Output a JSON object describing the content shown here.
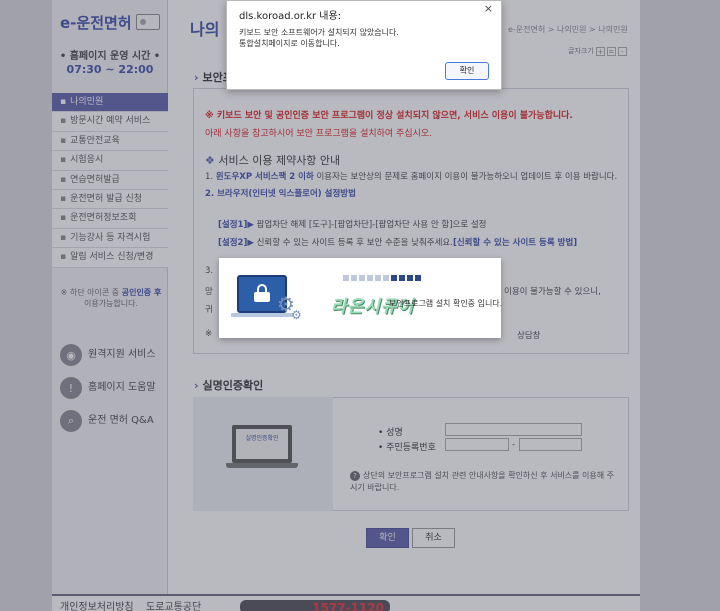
{
  "sidebar": {
    "logo": "e-운전면허",
    "hours_title": "• 홈페이지 운영 시간 •",
    "hours_time": "07:30 ~ 22:00",
    "nav": [
      "나의민원",
      "방문시간 예약 서비스",
      "교통안전교육",
      "시험응시",
      "연습면허발급",
      "운전면허 발급 신청",
      "운전면허정보조회",
      "기능강사 등 자격시험",
      "알림 서비스 신청/변경"
    ],
    "note_prefix": "※ 하단 아이콘 중 ",
    "note_link": "공인인증 후",
    "note_suffix": " 이용가능합니다.",
    "services": [
      {
        "icon": "wifi-icon",
        "label": "원격지원 서비스"
      },
      {
        "icon": "exclamation-icon",
        "label": "홈페이지 도움말"
      },
      {
        "icon": "search-icon",
        "label": "운전 면허 Q&A"
      }
    ]
  },
  "main": {
    "title": "나의 민원",
    "breadcrumb": "e-운전면허 > 나의민원 > 나의민원",
    "fontsize_label": "글자크기",
    "section1_title": "보안프로그램 설치 안내",
    "warn1": "※ 키보드 보안 및 공인인증 보안 프로그램이 정상 설치되지 않으면, 서비스 이용이 불가능합니다.",
    "warn2": "아래 사항을 참고하시어 보안 프로그램을 설치하여 주십시오.",
    "sub_title": "서비스 이용 제약사항 안내",
    "line1_pre": "1. ",
    "line1_b": "윈도우XP 서비스팩 2 이하",
    "line1_post": " 이용자는 보안상의 문제로 홈페이지 이용이 불가능하오니 업데이트 후 이용 바랍니다.",
    "line2": "2. 브라우저(인터넷 익스플로어) 설정방법",
    "step1_b": "[설정1]▶",
    "step1": " 팝업차단 해제 [도구]-[팝업차단]-[팝업차단 사용 안 함]으로 설정",
    "step2_b": "[설정2]▶",
    "step2": " 신뢰할 수 있는 사이트 등록 후 보안 수준을 낮춰주세요.",
    "step2_link": "[신뢰할 수 있는 사이트 등록 방법]",
    "line3": "3.",
    "partial_a": "망",
    "partial_b": "귀",
    "partial_c": "※",
    "partial_right1": "이용이 불가능할 수 있으니,",
    "partial_right2": "상담창",
    "section2_title": "실명인증확인",
    "laptop_text": "실명인증확인",
    "name_label": "성명",
    "rrn_label": "주민등록번호",
    "rrn_sep": "-",
    "info": "상단의 보안프로그램 설치 관련 안내사항을 확인하신 후 서비스를 이용해 주시기 바랍니다.",
    "info_icon": "?",
    "confirm": "확인",
    "cancel": "취소"
  },
  "footer": {
    "link1": "개인정보처리방침",
    "link2": "도로교통공단",
    "phone": "1577-1120"
  },
  "alert": {
    "title": "dls.koroad.or.kr 내용:",
    "close": "×",
    "msg1": "키보드 보안 소프트웨어가 설치되지 않았습니다.",
    "msg2": "통합설치페이지로 이동합니다.",
    "ok": "확인"
  },
  "install": {
    "brand": "라온시큐어",
    "msg": "보안프로그램 설치 확인중 입니다.",
    "progress_on": 4,
    "progress_total": 10
  },
  "colors": {
    "accent": "#5b5fa8",
    "warn": "#d22222",
    "brand": "#3a4ea8"
  }
}
